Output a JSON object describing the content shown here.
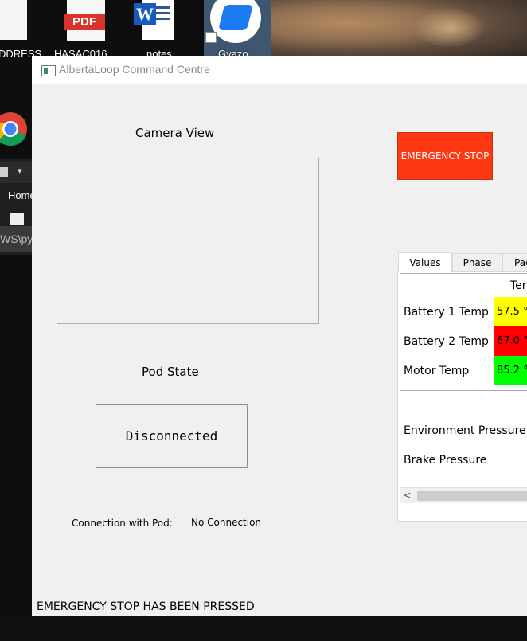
{
  "desktop": {
    "icons": [
      {
        "label": "DDRESS"
      },
      {
        "label": "HASAC016",
        "badge": "PDF"
      },
      {
        "label": "notes",
        "badge": "W"
      },
      {
        "label": "Gyazo"
      }
    ],
    "side_window": {
      "home_label": "Home",
      "path_text": "WS\\py"
    }
  },
  "window": {
    "title": "AlbertaLoop Command Centre"
  },
  "camera": {
    "title": "Camera View"
  },
  "pod_state": {
    "title": "Pod State",
    "value": "Disconnected"
  },
  "connection": {
    "label": "Connection with Pod:",
    "value": "No Connection"
  },
  "status_message": "EMERGENCY STOP HAS BEEN PRESSED",
  "emergency_stop": {
    "label": "EMERGENCY STOP",
    "color": "#ff3814"
  },
  "tabs": [
    {
      "label": "Values",
      "active": true
    },
    {
      "label": "Phase",
      "active": false
    },
    {
      "label": "Pac",
      "active": false
    }
  ],
  "values_table": {
    "column_header": "Ter",
    "rows": [
      {
        "label": "Battery 1 Temp",
        "value": "57.5 °",
        "color": "#ffff00"
      },
      {
        "label": "Battery 2 Temp",
        "value": "67.0 °",
        "color": "#ff0000"
      },
      {
        "label": "Motor Temp",
        "value": "85.2 °",
        "color": "#00ff00"
      }
    ]
  },
  "pressure_table": {
    "rows": [
      {
        "label": "Environment Pressure"
      },
      {
        "label": "Brake Pressure"
      }
    ]
  },
  "scrollbar": {
    "left_arrow": "<"
  }
}
